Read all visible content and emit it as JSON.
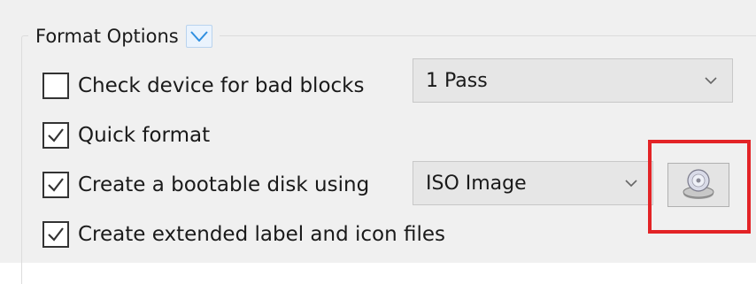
{
  "format_options": {
    "title": "Format Options",
    "toggle_icon": "chevron-down-icon",
    "check_bad_blocks": {
      "label": "Check device for bad blocks",
      "checked": false
    },
    "passes_select": {
      "value": "1 Pass",
      "icon": "chevron-down-icon"
    },
    "quick_format": {
      "label": "Quick format",
      "checked": true
    },
    "bootable": {
      "label": "Create a bootable disk using",
      "checked": true
    },
    "boot_type_select": {
      "value": "ISO Image",
      "icon": "chevron-down-icon"
    },
    "select_image_button": {
      "icon": "disc-drive-icon"
    },
    "extended_label": {
      "label": "Create extended label and icon files",
      "checked": true
    }
  },
  "colors": {
    "panel_background": "#f0f0f0",
    "highlight_border": "#e32326",
    "toggle_accent": "#2f8fe0",
    "checkmark": "#333333"
  }
}
